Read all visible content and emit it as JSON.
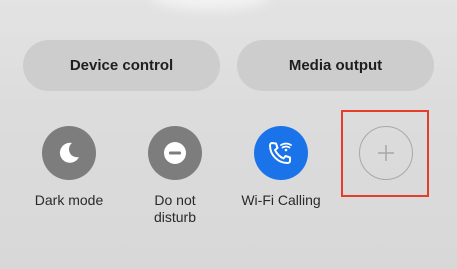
{
  "quick_buttons": {
    "device_control": "Device control",
    "media_output": "Media output"
  },
  "tiles": [
    {
      "id": "dark-mode",
      "lines": [
        "Dark mode"
      ],
      "icon": "moon-icon",
      "state": "off"
    },
    {
      "id": "do-not-disturb",
      "lines": [
        "Do not",
        "disturb"
      ],
      "icon": "minus-circle-icon",
      "state": "off"
    },
    {
      "id": "wifi-calling",
      "lines": [
        "Wi-Fi Calling"
      ],
      "icon": "wifi-phone-icon",
      "state": "on"
    },
    {
      "id": "add-tile",
      "lines": [],
      "icon": "plus-icon",
      "state": "empty"
    }
  ],
  "colors": {
    "tile_off": "#7d7d7d",
    "tile_on": "#1a73e8",
    "highlight": "#e63c2a"
  }
}
